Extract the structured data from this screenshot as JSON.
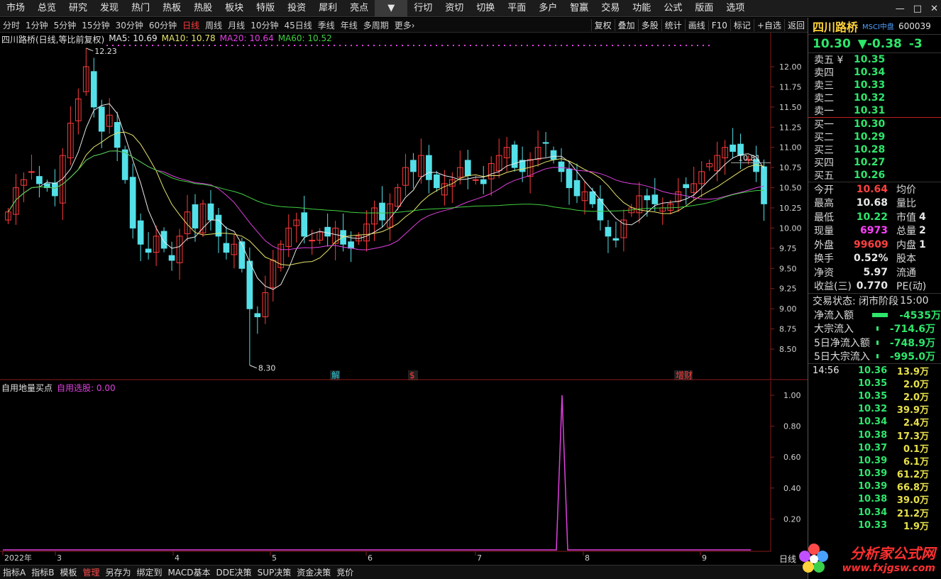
{
  "menu": [
    "市场",
    "总览",
    "研究",
    "发现",
    "热门",
    "热板",
    "热股",
    "板块",
    "特版",
    "投资",
    "犀利",
    "亮点",
    "▼",
    "行切",
    "资切",
    "切换",
    "平面",
    "多户",
    "智赢",
    "交易",
    "功能",
    "公式",
    "版面",
    "选项"
  ],
  "window_controls": [
    "—",
    "□",
    "✕"
  ],
  "periods": [
    "分时",
    "1分钟",
    "5分钟",
    "15分钟",
    "30分钟",
    "60分钟",
    "日线",
    "周线",
    "月线",
    "10分钟",
    "45日线",
    "季线",
    "年线",
    "多周期",
    "更多›"
  ],
  "active_period": "日线",
  "tools": [
    "复权",
    "叠加",
    "多股",
    "统计",
    "画线",
    "F10",
    "标记",
    "+自选",
    "返回"
  ],
  "main_header": {
    "stock_desc": "四川路桥(日线,等比前复权)",
    "ma5": "MA5: 10.69",
    "ma10": "MA10: 10.78",
    "ma20": "MA20: 10.64",
    "ma60": "MA60: 10.52"
  },
  "price_axis": [
    "12.00",
    "11.75",
    "11.50",
    "11.25",
    "11.00",
    "10.75",
    "10.50",
    "10.25",
    "10.00",
    "9.75",
    "9.50",
    "9.25",
    "9.00",
    "8.75",
    "8.50"
  ],
  "annotations": {
    "high": "12.23",
    "low": "8.30",
    "last": "10.81",
    "jie": "解",
    "s": "$",
    "zengcai": "增财"
  },
  "time_axis": [
    "2022年",
    "3",
    "4",
    "5",
    "6",
    "7",
    "8",
    "9"
  ],
  "sub_header": {
    "name": "自用地量买点",
    "label": "自用选股: 0.00"
  },
  "sub_axis": [
    "1.00",
    "0.80",
    "0.60",
    "0.40",
    "0.20"
  ],
  "bottom_tabs": [
    "指标A",
    "指标B",
    "模板",
    "管理",
    "另存为",
    "绑定到",
    "MACD基本",
    "DDE决策",
    "SUP决策",
    "资金决策",
    "竞价"
  ],
  "active_tab": "管理",
  "day_label": "日线",
  "quote": {
    "name": "四川路桥",
    "tag": "MSCI中盘",
    "code": "600039",
    "last": "10.30",
    "change": "▼-0.38",
    "change_pct": "-3",
    "asks": [
      {
        "label": "卖五 ¥",
        "price": "10.35"
      },
      {
        "label": "卖四",
        "price": "10.34"
      },
      {
        "label": "卖三",
        "price": "10.33"
      },
      {
        "label": "卖二",
        "price": "10.32"
      },
      {
        "label": "卖一",
        "price": "10.31"
      }
    ],
    "bids": [
      {
        "label": "买一",
        "price": "10.30"
      },
      {
        "label": "买二",
        "price": "10.29"
      },
      {
        "label": "买三",
        "price": "10.28"
      },
      {
        "label": "买四",
        "price": "10.27"
      },
      {
        "label": "买五",
        "price": "10.26"
      }
    ],
    "stats": [
      {
        "l1": "今开",
        "v1": "10.64",
        "c1": "red",
        "l2": "均价",
        "v2": ""
      },
      {
        "l1": "最高",
        "v1": "10.68",
        "c1": "white",
        "l2": "量比",
        "v2": ""
      },
      {
        "l1": "最低",
        "v1": "10.22",
        "c1": "green",
        "l2": "市值",
        "v2": "4"
      },
      {
        "l1": "现量",
        "v1": "6973",
        "c1": "mag",
        "l2": "总量",
        "v2": "2"
      },
      {
        "l1": "外盘",
        "v1": "99609",
        "c1": "red",
        "l2": "内盘",
        "v2": "1"
      },
      {
        "l1": "换手",
        "v1": "0.52%",
        "c1": "white",
        "l2": "股本",
        "v2": ""
      },
      {
        "l1": "净资",
        "v1": "5.97",
        "c1": "white",
        "l2": "流通",
        "v2": ""
      },
      {
        "l1": "收益(三)",
        "v1": "0.770",
        "c1": "white",
        "l2": "PE(动)",
        "v2": ""
      }
    ],
    "status": "交易状态: 闭市阶段",
    "status_time": "15:00",
    "flows": [
      {
        "label": "净流入额",
        "value": "-4535万"
      },
      {
        "label": "大宗流入",
        "value": "-714.6万"
      },
      {
        "label": "5日净流入额",
        "value": "-748.9万"
      },
      {
        "label": "5日大宗流入",
        "value": "-995.0万"
      }
    ],
    "ticks": [
      {
        "time": "14:56",
        "price": "10.36",
        "vol": "13.9万"
      },
      {
        "time": "",
        "price": "10.35",
        "vol": "2.0万"
      },
      {
        "time": "",
        "price": "10.35",
        "vol": "2.0万"
      },
      {
        "time": "",
        "price": "10.32",
        "vol": "39.9万"
      },
      {
        "time": "",
        "price": "10.34",
        "vol": "2.4万"
      },
      {
        "time": "",
        "price": "10.38",
        "vol": "17.3万"
      },
      {
        "time": "",
        "price": "10.37",
        "vol": "0.1万"
      },
      {
        "time": "",
        "price": "10.39",
        "vol": "6.1万"
      },
      {
        "time": "",
        "price": "10.39",
        "vol": "61.2万"
      },
      {
        "time": "",
        "price": "10.39",
        "vol": "66.8万"
      },
      {
        "time": "",
        "price": "10.38",
        "vol": "39.0万"
      },
      {
        "time": "",
        "price": "10.34",
        "vol": "21.2万"
      },
      {
        "time": "",
        "price": "10.33",
        "vol": "1.9万"
      }
    ]
  },
  "logo": {
    "text": "分析家公式网",
    "url": "www.fxjgsw.com"
  },
  "colors": {
    "up": "#ff3b3b",
    "down": "#54e0e8",
    "ma5": "#e8e8e8",
    "ma10": "#e8e46a",
    "ma20": "#e040e0",
    "ma60": "#40d040",
    "indicator": "#e040e0"
  },
  "chart_data": {
    "type": "candlestick",
    "title": "四川路桥(日线,等比前复权)",
    "ylim": [
      8.3,
      12.23
    ],
    "close_series": [
      10.2,
      10.5,
      10.6,
      10.7,
      10.55,
      10.5,
      10.4,
      10.9,
      11.3,
      11.6,
      12.0,
      11.5,
      11.2,
      11.4,
      11.0,
      10.6,
      10.0,
      9.8,
      9.7,
      9.9,
      9.75,
      9.6,
      9.9,
      10.2,
      10.0,
      10.3,
      10.1,
      9.9,
      9.7,
      9.8,
      9.5,
      9.0,
      8.9,
      9.2,
      9.6,
      9.8,
      10.0,
      10.1,
      9.9,
      9.85,
      9.95,
      9.9,
      10.0,
      9.8,
      9.75,
      9.9,
      10.05,
      10.25,
      10.1,
      10.3,
      10.5,
      10.75,
      10.7,
      10.9,
      10.6,
      10.5,
      10.55,
      10.6,
      10.75,
      10.65,
      10.6,
      10.55,
      10.8,
      10.9,
      11.0,
      10.75,
      10.7,
      10.85,
      11.0,
      11.05,
      10.85,
      10.7,
      10.5,
      10.4,
      10.45,
      10.3,
      10.1,
      9.9,
      9.85,
      10.1,
      10.25,
      10.4,
      10.35,
      10.3,
      10.25,
      10.3,
      10.45,
      10.5,
      10.55,
      10.7,
      10.8,
      10.9,
      11.0,
      10.95,
      10.9,
      10.85,
      10.7,
      10.3
    ],
    "indicator": {
      "name": "自用地量买点",
      "ylim": [
        0,
        1
      ],
      "spike_index": 63,
      "spike_value": 1.0
    }
  }
}
